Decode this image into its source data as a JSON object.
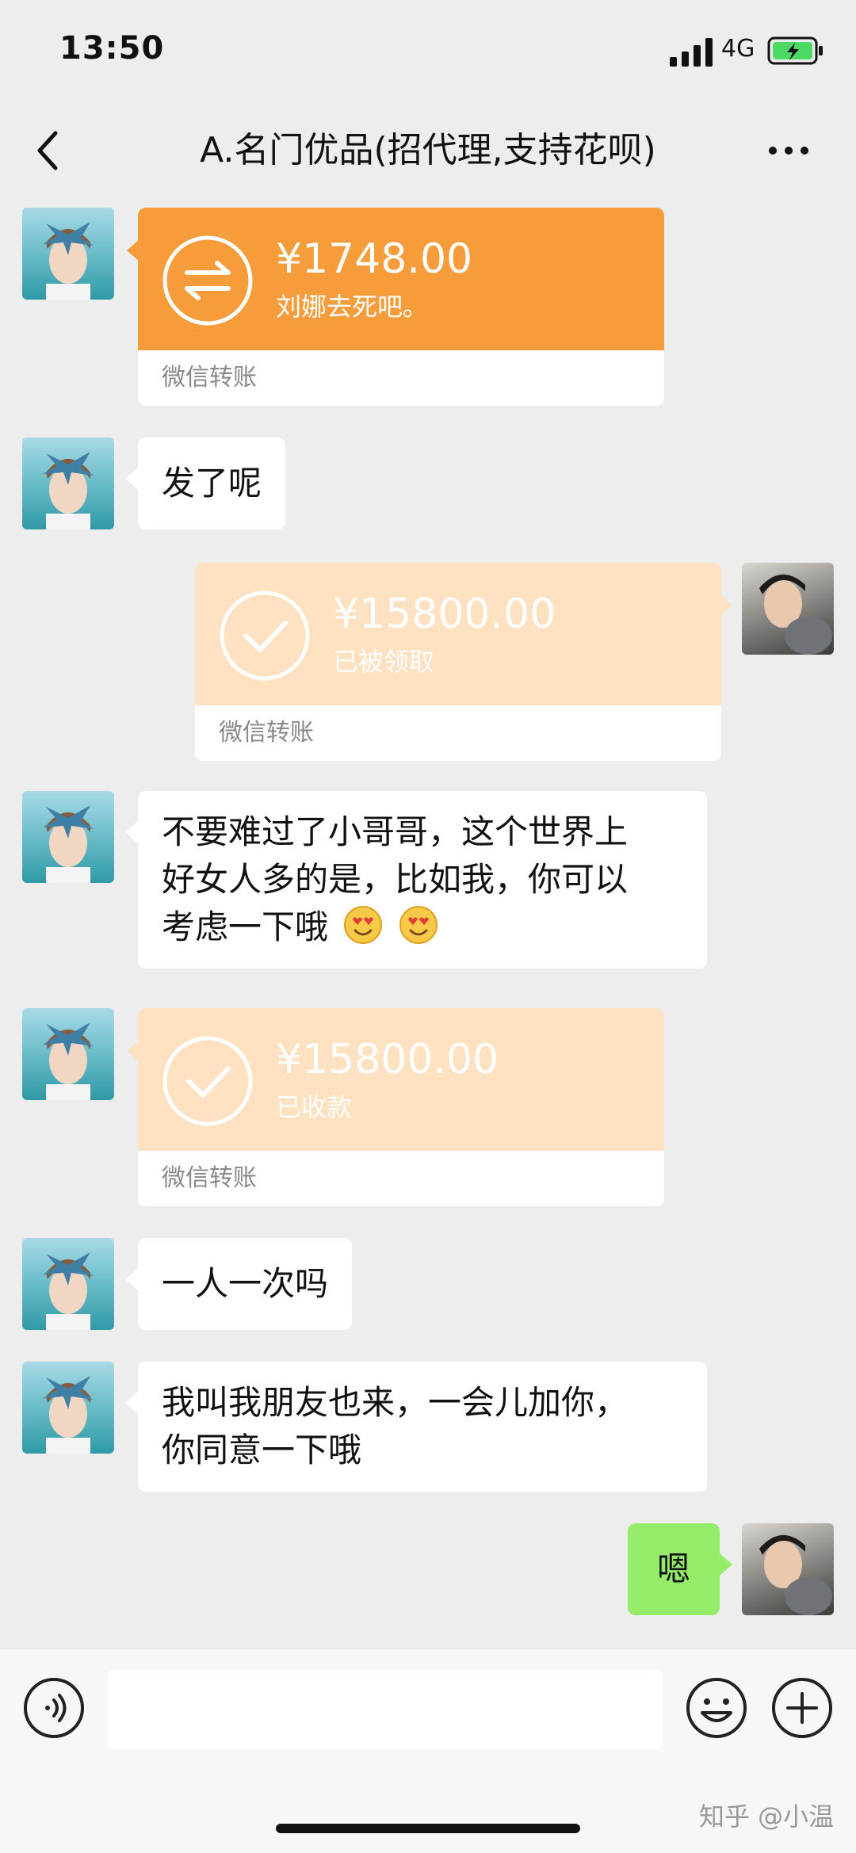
{
  "status_bar": {
    "time": "13:50",
    "network": "4G"
  },
  "header": {
    "title": "A.名门优品(招代理,支持花呗)"
  },
  "messages": {
    "m1": {
      "amount": "¥1748.00",
      "note": "刘娜去死吧。",
      "footer": "微信转账"
    },
    "m2": {
      "text": "发了呢"
    },
    "m3": {
      "amount": "¥15800.00",
      "status": "已被领取",
      "footer": "微信转账"
    },
    "m4": {
      "line1": "不要难过了小哥哥，这个世界上",
      "line2": "好女人多的是，比如我，你可以",
      "line3": "考虑一下哦"
    },
    "m5": {
      "amount": "¥15800.00",
      "status": "已收款",
      "footer": "微信转账"
    },
    "m6": {
      "text": "一人一次吗"
    },
    "m7": {
      "line1": "我叫我朋友也来，一会儿加你，",
      "line2": "你同意一下哦"
    },
    "m8": {
      "text": "嗯"
    }
  },
  "watermark": "知乎 @小温",
  "colors": {
    "transfer_active": "#f79c3a",
    "transfer_done": "#fde1c1",
    "my_bubble": "#95ec69",
    "background": "#ededed"
  }
}
